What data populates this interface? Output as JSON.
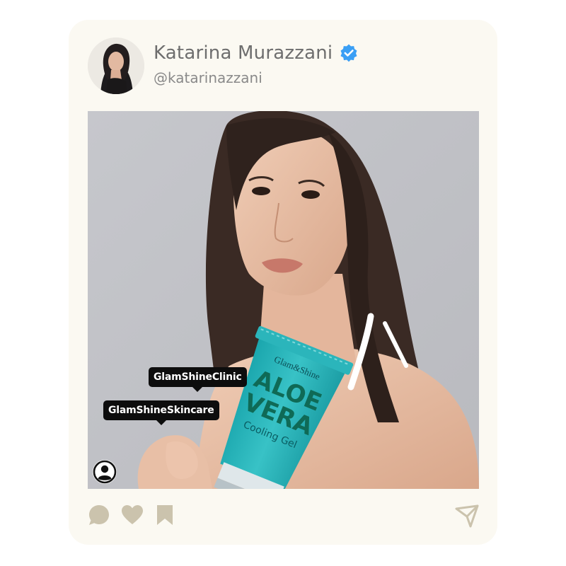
{
  "post": {
    "author": {
      "display_name": "Katarina Murazzani",
      "handle": "@katarinazzani",
      "verified": true,
      "verified_color": "#3a9ff5"
    },
    "product_tags": [
      {
        "label": "GlamShineClinic"
      },
      {
        "label": "GlamShineSkincare"
      }
    ],
    "product": {
      "brand": "Glam&Shine",
      "line1": "ALOE",
      "line2": "VERA",
      "subtitle": "Cooling Gel"
    },
    "actions": {
      "icons": [
        "comment-icon",
        "heart-icon",
        "bookmark-icon",
        "share-icon"
      ],
      "icon_color": "#cbc3ad"
    },
    "colors": {
      "card_background": "#fbf9f2",
      "tube": "#2bb5bb",
      "tag_background": "#0d0d0d"
    }
  }
}
